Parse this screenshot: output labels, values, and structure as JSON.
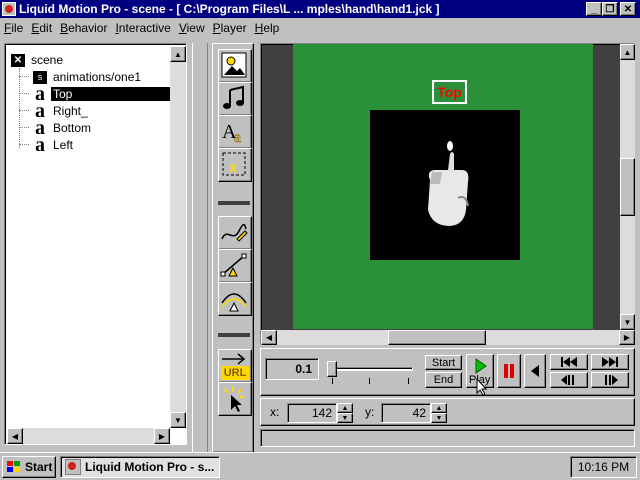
{
  "window": {
    "title": "Liquid Motion Pro - scene - [ C:\\Program Files\\L ... mples\\hand\\hand1.jck ]"
  },
  "menu": [
    "File",
    "Edit",
    "Behavior",
    "Interactive",
    "View",
    "Player",
    "Help"
  ],
  "tree": {
    "root": "scene",
    "items": [
      {
        "label": "animations/one1",
        "selected": false
      },
      {
        "label": "Top",
        "selected": true
      },
      {
        "label": "Right_",
        "selected": false
      },
      {
        "label": "Bottom",
        "selected": false
      },
      {
        "label": "Left",
        "selected": false
      }
    ]
  },
  "stage": {
    "selected_label": "Top"
  },
  "playback": {
    "time_value": "0.1",
    "start_label": "Start",
    "end_label": "End",
    "play_label": "Play"
  },
  "coords": {
    "x_label": "x:",
    "x_value": "142",
    "y_label": "y:",
    "y_value": "42"
  },
  "tools": {
    "url_label": "URL"
  },
  "taskbar": {
    "start_label": "Start",
    "task_label": "Liquid Motion Pro - s...",
    "clock": "10:16 PM"
  },
  "colors": {
    "titlebar": "#000080",
    "stage_bg": "#2a9138",
    "selection_text": "#ff0000"
  }
}
